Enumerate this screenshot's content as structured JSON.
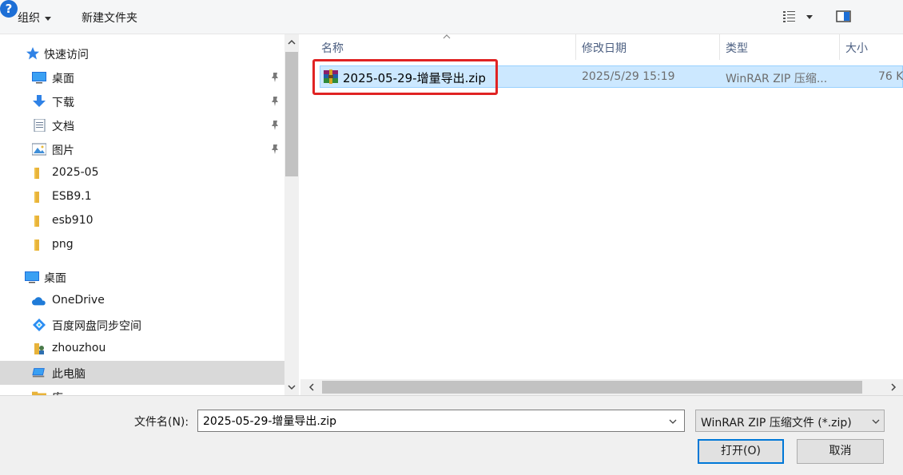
{
  "toolbar": {
    "organize": "组织",
    "new_folder": "新建文件夹",
    "help": "?"
  },
  "nav": {
    "items": [
      {
        "label": "快速访问",
        "icon": "star-icon"
      },
      {
        "label": "桌面",
        "icon": "desktop-icon",
        "pinned": true
      },
      {
        "label": "下载",
        "icon": "download-icon",
        "pinned": true
      },
      {
        "label": "文档",
        "icon": "document-icon",
        "pinned": true
      },
      {
        "label": "图片",
        "icon": "pictures-icon",
        "pinned": true
      },
      {
        "label": "2025-05",
        "icon": "folder-icon"
      },
      {
        "label": "ESB9.1",
        "icon": "folder-icon"
      },
      {
        "label": "esb910",
        "icon": "folder-icon"
      },
      {
        "label": "png",
        "icon": "folder-icon"
      },
      {
        "label": "桌面",
        "icon": "desktop-icon"
      },
      {
        "label": "OneDrive",
        "icon": "onedrive-icon"
      },
      {
        "label": "百度网盘同步空间",
        "icon": "baidu-netdisk-icon"
      },
      {
        "label": "zhouzhou",
        "icon": "user-icon"
      },
      {
        "label": "此电脑",
        "icon": "computer-icon",
        "selected": true
      },
      {
        "label": "库",
        "icon": "library-icon"
      }
    ]
  },
  "files": {
    "columns": {
      "name": "名称",
      "date": "修改日期",
      "type": "类型",
      "size": "大小"
    },
    "rows": [
      {
        "name": "2025-05-29-增量导出.zip",
        "date": "2025/5/29 15:19",
        "type": "WinRAR ZIP 压缩...",
        "size": "76 K"
      }
    ]
  },
  "bottom": {
    "filename_label": "文件名(N):",
    "filename_value": "2025-05-29-增量导出.zip",
    "filetype_value": "WinRAR ZIP 压缩文件 (*.zip)",
    "open_label": "打开(O)",
    "cancel_label": "取消"
  },
  "colors": {
    "selected_row": "#cce8ff",
    "highlight_box": "#e02323",
    "accent": "#0078d7"
  }
}
